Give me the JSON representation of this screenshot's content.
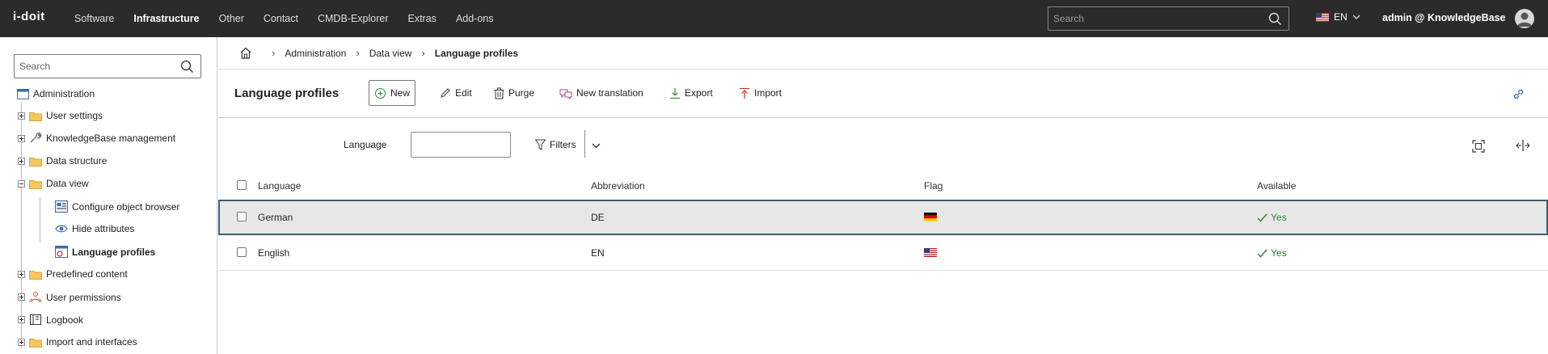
{
  "topbar": {
    "logo": "i-doit",
    "nav": [
      "Software",
      "Infrastructure",
      "Other",
      "Contact",
      "CMDB-Explorer",
      "Extras",
      "Add-ons"
    ],
    "active_nav": "Infrastructure",
    "search_placeholder": "Search",
    "language": "EN",
    "user": "admin @ KnowledgeBase"
  },
  "sidebar": {
    "search_placeholder": "Search",
    "root": "Administration",
    "items": [
      {
        "label": "User settings"
      },
      {
        "label": "KnowledgeBase management"
      },
      {
        "label": "Data structure"
      },
      {
        "label": "Data view"
      },
      {
        "label": "Configure object browser"
      },
      {
        "label": "Hide attributes"
      },
      {
        "label": "Language profiles"
      },
      {
        "label": "Predefined content"
      },
      {
        "label": "User permissions"
      },
      {
        "label": "Logbook"
      },
      {
        "label": "Import and interfaces"
      }
    ]
  },
  "breadcrumb": [
    "Administration",
    "Data view",
    "Language profiles"
  ],
  "toolbar": {
    "title": "Language profiles",
    "new": "New",
    "edit": "Edit",
    "purge": "Purge",
    "new_translation": "New translation",
    "export": "Export",
    "import": "Import"
  },
  "filter": {
    "label": "Language",
    "value": "",
    "filters": "Filters"
  },
  "table": {
    "columns": [
      "Language",
      "Abbreviation",
      "Flag",
      "Available"
    ],
    "rows": [
      {
        "language": "German",
        "abbreviation": "DE",
        "flag": "german-flag",
        "available": "Yes"
      },
      {
        "language": "English",
        "abbreviation": "EN",
        "flag": "us-flag",
        "available": "Yes"
      }
    ]
  },
  "colors": {
    "topbar": "#2b2b2b",
    "accent": "#3f5f6f",
    "available": "#2e8b2e"
  }
}
